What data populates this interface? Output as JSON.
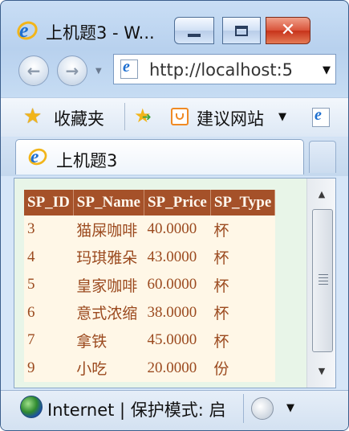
{
  "window": {
    "title": "上机题3 - W...",
    "buttons": {
      "minimize": "—",
      "maximize": "□",
      "close": "✕"
    }
  },
  "nav": {
    "back_icon": "back-arrow-icon",
    "forward_icon": "forward-arrow-icon",
    "address": "http://localhost:5"
  },
  "favorites": {
    "label": "收藏夹",
    "suggested": "建议网站"
  },
  "tab": {
    "label": "上机题3"
  },
  "table": {
    "headers": [
      "SP_ID",
      "SP_Name",
      "SP_Price",
      "SP_Type"
    ],
    "rows": [
      [
        "3",
        "猫屎咖啡",
        "40.0000",
        "杯"
      ],
      [
        "4",
        "玛琪雅朵",
        "43.0000",
        "杯"
      ],
      [
        "5",
        "皇家咖啡",
        "60.0000",
        "杯"
      ],
      [
        "6",
        "意式浓缩",
        "38.0000",
        "杯"
      ],
      [
        "7",
        "拿铁",
        "45.0000",
        "杯"
      ],
      [
        "9",
        "小吃",
        "20.0000",
        "份"
      ]
    ]
  },
  "status": {
    "text": "Internet | 保护模式: 启"
  },
  "colors": {
    "header_bg": "#a55129",
    "row_bg": "#fff7e7",
    "row_text": "#9b4a1f",
    "page_bg": "#e8f5e8"
  }
}
